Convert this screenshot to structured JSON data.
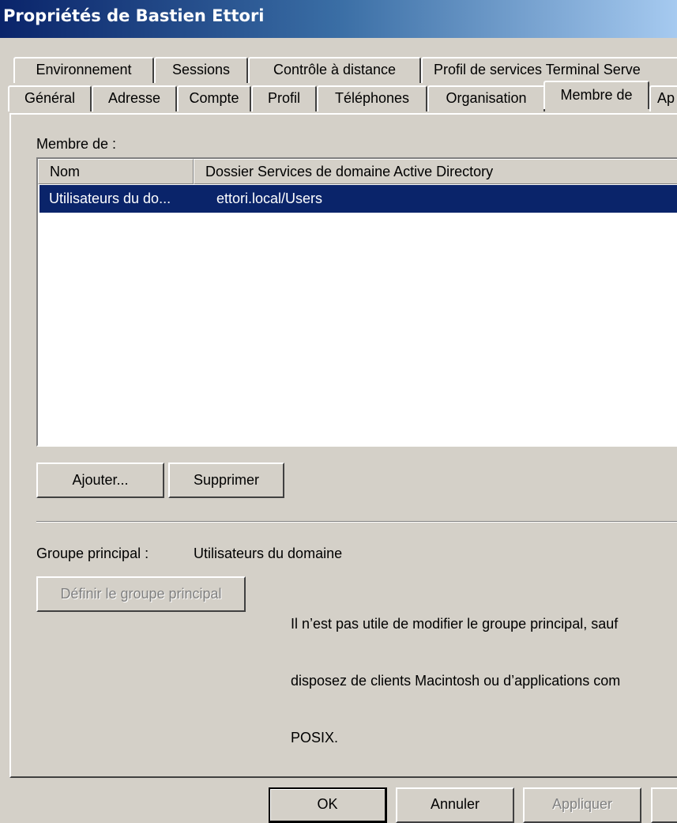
{
  "window": {
    "title": "Propriétés de Bastien Ettori"
  },
  "tabs_row1": [
    "Environnement",
    "Sessions",
    "Contrôle à distance",
    "Profil de services Terminal Serve"
  ],
  "tabs_row2": [
    "Général",
    "Adresse",
    "Compte",
    "Profil",
    "Téléphones",
    "Organisation",
    "Membre de",
    "Ap"
  ],
  "active_tab": "Membre de",
  "member_of": {
    "label": "Membre de :",
    "columns": [
      "Nom",
      "Dossier Services de domaine Active Directory"
    ],
    "rows": [
      {
        "name": "Utilisateurs du do...",
        "folder": "ettori.local/Users",
        "selected": true
      }
    ],
    "add_button": "Ajouter...",
    "remove_button": "Supprimer"
  },
  "primary_group": {
    "label": "Groupe principal :",
    "value": "Utilisateurs du domaine",
    "set_button": "Définir le groupe principal",
    "info_lines": [
      "Il n’est pas utile de modifier le groupe principal, sauf",
      "disposez de clients Macintosh ou d’applications com",
      "POSIX."
    ]
  },
  "footer": {
    "ok": "OK",
    "cancel": "Annuler",
    "apply": "Appliquer"
  },
  "colors": {
    "selection": "#0a246a",
    "face": "#d4d0c8",
    "title_start": "#0a246a"
  }
}
